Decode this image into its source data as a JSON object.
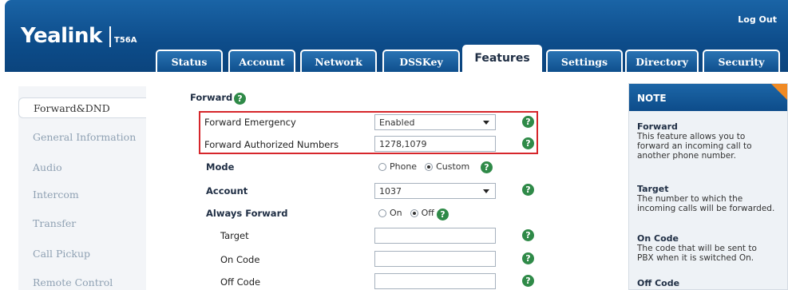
{
  "header": {
    "logo": "Yealink",
    "model": "T56A",
    "logout": "Log Out",
    "tabs": [
      {
        "label": "Status"
      },
      {
        "label": "Account"
      },
      {
        "label": "Network"
      },
      {
        "label": "DSSKey"
      },
      {
        "label": "Features",
        "active": true
      },
      {
        "label": "Settings"
      },
      {
        "label": "Directory"
      },
      {
        "label": "Security"
      }
    ]
  },
  "sidebar": {
    "items": [
      {
        "label": "Forward&DND",
        "active": true
      },
      {
        "label": "General Information"
      },
      {
        "label": "Audio"
      },
      {
        "label": "Intercom"
      },
      {
        "label": "Transfer"
      },
      {
        "label": "Call Pickup"
      },
      {
        "label": "Remote Control"
      }
    ]
  },
  "main": {
    "section_title": "Forward",
    "forward_emergency": {
      "label": "Forward Emergency",
      "value": "Enabled"
    },
    "forward_authorized": {
      "label": "Forward Authorized Numbers",
      "value": "1278,1079"
    },
    "mode": {
      "label": "Mode",
      "options": [
        "Phone",
        "Custom"
      ],
      "selected": "Custom"
    },
    "account": {
      "label": "Account",
      "value": "1037"
    },
    "always_forward": {
      "label": "Always Forward",
      "options": [
        "On",
        "Off"
      ],
      "selected": "Off"
    },
    "target": {
      "label": "Target",
      "value": ""
    },
    "on_code": {
      "label": "On Code",
      "value": ""
    },
    "off_code": {
      "label": "Off Code",
      "value": ""
    },
    "help_glyph": "?"
  },
  "note": {
    "title": "NOTE",
    "blocks": [
      {
        "heading": "Forward",
        "lines": [
          "This feature allows you to",
          "forward an incoming call to",
          "another phone number."
        ]
      },
      {
        "heading": "Target",
        "lines": [
          "The number to which the",
          "incoming calls will be forwarded."
        ]
      },
      {
        "heading": "On Code",
        "lines": [
          "The code that will be sent to",
          "PBX when it is switched On."
        ]
      },
      {
        "heading": "Off Code",
        "lines": []
      }
    ]
  },
  "colors": {
    "header_blue": "#0d4c8a",
    "help_green": "#2f8a48",
    "highlight_red": "#d6262b",
    "note_accent_orange": "#f08a24"
  }
}
